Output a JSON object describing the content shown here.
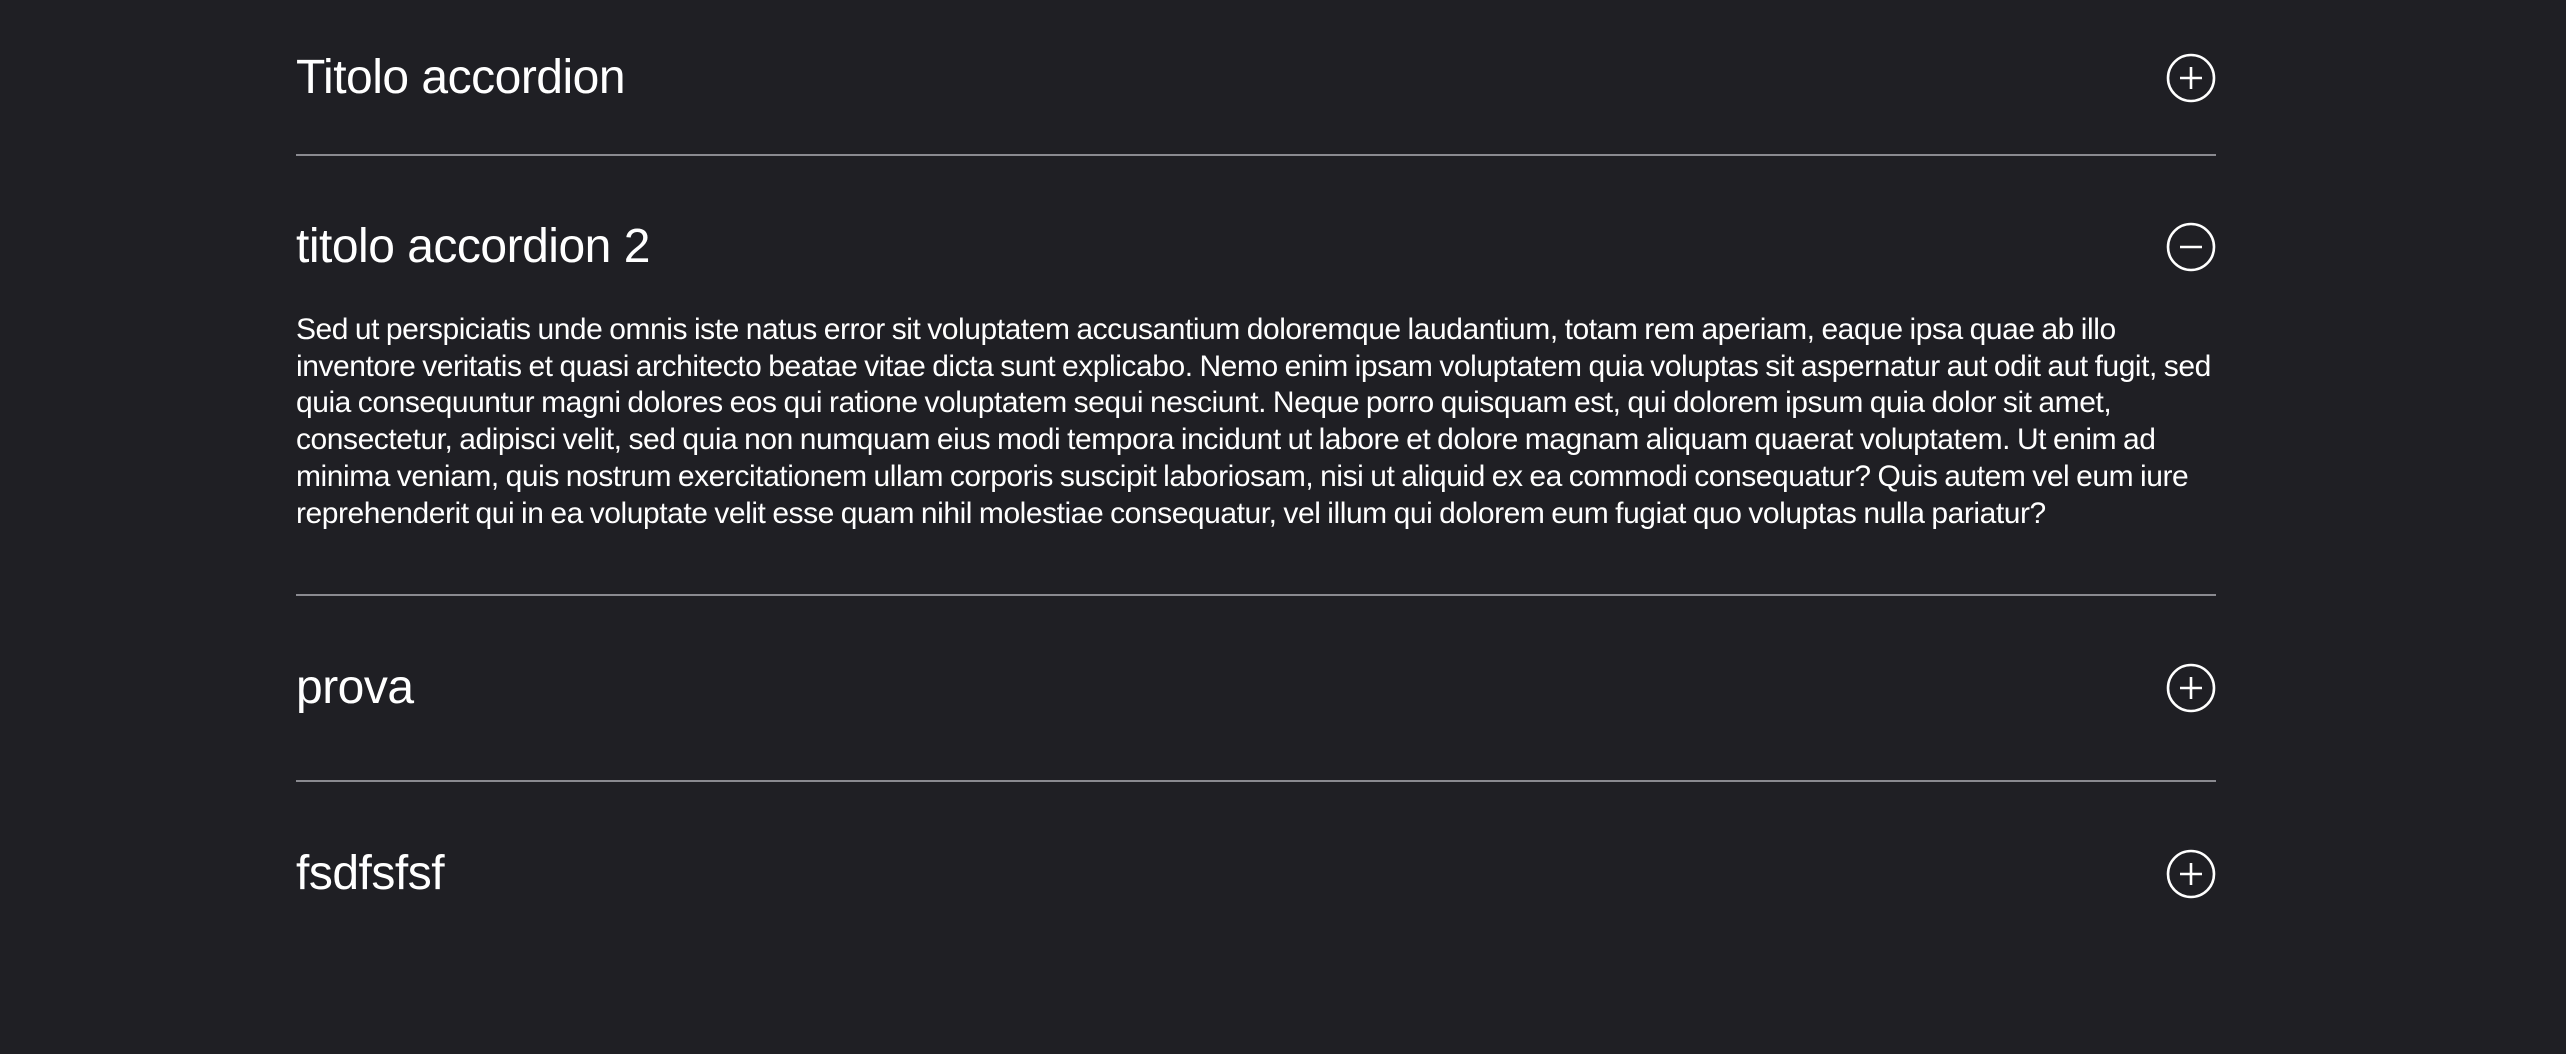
{
  "accordion": {
    "items": [
      {
        "title": "Titolo accordion",
        "state": "collapsed",
        "icon": "plus-circle-icon"
      },
      {
        "title": "titolo accordion 2",
        "state": "expanded",
        "icon": "minus-circle-icon",
        "body": "Sed ut perspiciatis unde omnis iste natus error sit voluptatem accusantium doloremque laudantium, totam rem aperiam, eaque ipsa quae ab illo inventore veritatis et quasi architecto beatae vitae dicta sunt explicabo. Nemo enim ipsam voluptatem quia voluptas sit aspernatur aut odit aut fugit, sed quia consequuntur magni dolores eos qui ratione voluptatem sequi nesciunt. Neque porro quisquam est, qui dolorem ipsum quia dolor sit amet, consectetur, adipisci velit, sed quia non numquam eius modi tempora incidunt ut labore et dolore magnam aliquam quaerat voluptatem. Ut enim ad minima veniam, quis nostrum exercitationem ullam corporis suscipit laboriosam, nisi ut aliquid ex ea commodi consequatur? Quis autem vel eum iure reprehenderit qui in ea voluptate velit esse quam nihil molestiae consequatur, vel illum qui dolorem eum fugiat quo voluptas nulla pariatur?"
      },
      {
        "title": "prova",
        "state": "collapsed",
        "icon": "plus-circle-icon"
      },
      {
        "title": "fsdfsfsf",
        "state": "collapsed",
        "icon": "plus-circle-icon"
      }
    ]
  },
  "colors": {
    "background": "#1f1f24",
    "text": "#ffffff",
    "divider": "#8a8a90"
  }
}
